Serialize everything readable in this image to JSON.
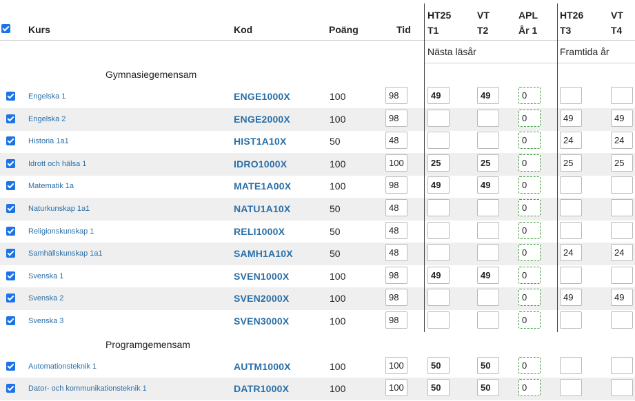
{
  "header": {
    "kurs": "Kurs",
    "kod": "Kod",
    "poang": "Poäng",
    "tid": "Tid",
    "ht25": "HT25",
    "t1": "T1",
    "vt1": "VT",
    "t2": "T2",
    "apl": "APL",
    "ar1": "År 1",
    "ht26": "HT26",
    "t3": "T3",
    "vt2": "VT",
    "t4": "T4",
    "nasta_lasar": "Nästa läsår",
    "framtida_ar": "Framtida år"
  },
  "colors": {
    "accent": "#1a73e8",
    "link": "#2a6fa8",
    "apl_border": "#3c9a3c",
    "row_alt": "#efefef"
  },
  "groups": [
    {
      "title": "Gymnasiegemensam",
      "rows": [
        {
          "course": "Engelska 1",
          "code": "ENGE1000X",
          "points": "100",
          "tid": "98",
          "t1": "49",
          "t2": "49",
          "apl": "0",
          "t3": "",
          "t4": ""
        },
        {
          "course": "Engelska 2",
          "code": "ENGE2000X",
          "points": "100",
          "tid": "98",
          "t1": "",
          "t2": "",
          "apl": "0",
          "t3": "49",
          "t4": "49"
        },
        {
          "course": "Historia 1a1",
          "code": "HIST1A10X",
          "points": "50",
          "tid": "48",
          "t1": "",
          "t2": "",
          "apl": "0",
          "t3": "24",
          "t4": "24"
        },
        {
          "course": "Idrott och hälsa 1",
          "code": "IDRO1000X",
          "points": "100",
          "tid": "100",
          "t1": "25",
          "t2": "25",
          "apl": "0",
          "t3": "25",
          "t4": "25"
        },
        {
          "course": "Matematik 1a",
          "code": "MATE1A00X",
          "points": "100",
          "tid": "98",
          "t1": "49",
          "t2": "49",
          "apl": "0",
          "t3": "",
          "t4": ""
        },
        {
          "course": "Naturkunskap 1a1",
          "code": "NATU1A10X",
          "points": "50",
          "tid": "48",
          "t1": "",
          "t2": "",
          "apl": "0",
          "t3": "",
          "t4": ""
        },
        {
          "course": "Religionskunskap 1",
          "code": "RELI1000X",
          "points": "50",
          "tid": "48",
          "t1": "",
          "t2": "",
          "apl": "0",
          "t3": "",
          "t4": ""
        },
        {
          "course": "Samhällskunskap 1a1",
          "code": "SAMH1A10X",
          "points": "50",
          "tid": "48",
          "t1": "",
          "t2": "",
          "apl": "0",
          "t3": "24",
          "t4": "24"
        },
        {
          "course": "Svenska 1",
          "code": "SVEN1000X",
          "points": "100",
          "tid": "98",
          "t1": "49",
          "t2": "49",
          "apl": "0",
          "t3": "",
          "t4": ""
        },
        {
          "course": "Svenska 2",
          "code": "SVEN2000X",
          "points": "100",
          "tid": "98",
          "t1": "",
          "t2": "",
          "apl": "0",
          "t3": "49",
          "t4": "49"
        },
        {
          "course": "Svenska 3",
          "code": "SVEN3000X",
          "points": "100",
          "tid": "98",
          "t1": "",
          "t2": "",
          "apl": "0",
          "t3": "",
          "t4": ""
        }
      ]
    },
    {
      "title": "Programgemensam",
      "rows": [
        {
          "course": "Automationsteknik 1",
          "code": "AUTM1000X",
          "points": "100",
          "tid": "100",
          "t1": "50",
          "t2": "50",
          "apl": "0",
          "t3": "",
          "t4": ""
        },
        {
          "course": "Dator- och kommunikationsteknik 1",
          "code": "DATR1000X",
          "points": "100",
          "tid": "100",
          "t1": "50",
          "t2": "50",
          "apl": "0",
          "t3": "",
          "t4": ""
        }
      ]
    }
  ]
}
